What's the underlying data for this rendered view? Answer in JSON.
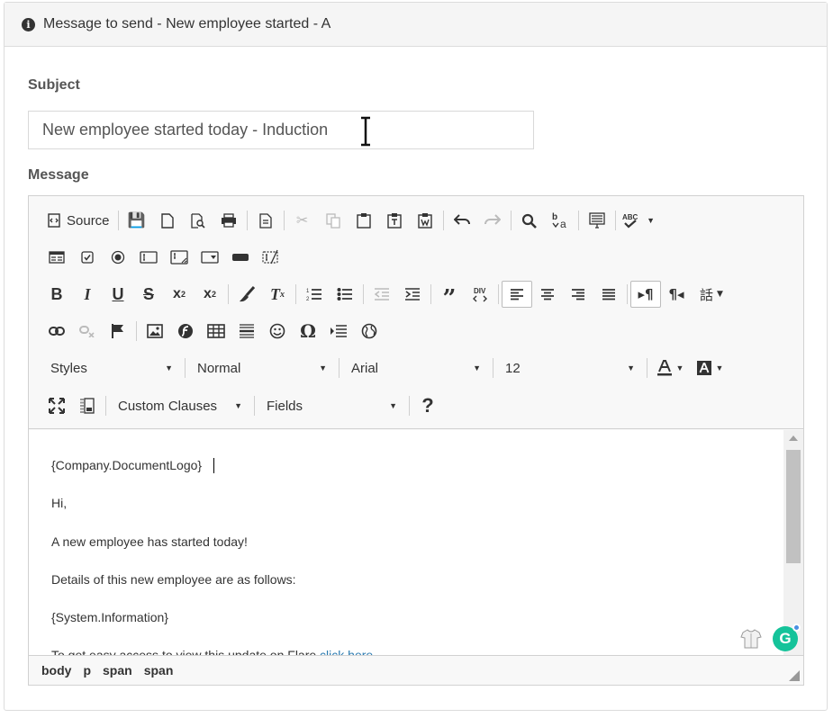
{
  "panel": {
    "title": "Message to send - New employee started - A",
    "title_icon": "info-icon"
  },
  "subject": {
    "label": "Subject",
    "value": "New employee started today - Induction"
  },
  "message": {
    "label": "Message"
  },
  "toolbar": {
    "source_label": "Source",
    "styles_value": "Styles",
    "format_value": "Normal",
    "font_value": "Arial",
    "size_value": "12",
    "custom_clauses_value": "Custom Clauses",
    "fields_value": "Fields",
    "help_label": "?"
  },
  "content": {
    "lines": [
      "{Company.DocumentLogo}",
      "Hi,",
      "A new employee has started today!",
      "Details of this new employee are as follows:",
      "{System.Information}",
      "To get easy access to view this update on Flare "
    ],
    "link_text": "click here"
  },
  "statusbar": {
    "path": [
      "body",
      "p",
      "span",
      "span"
    ]
  },
  "colors": {
    "link": "#2a7ab0",
    "grammarly": "#15c39a",
    "border": "#d1d1d1"
  }
}
